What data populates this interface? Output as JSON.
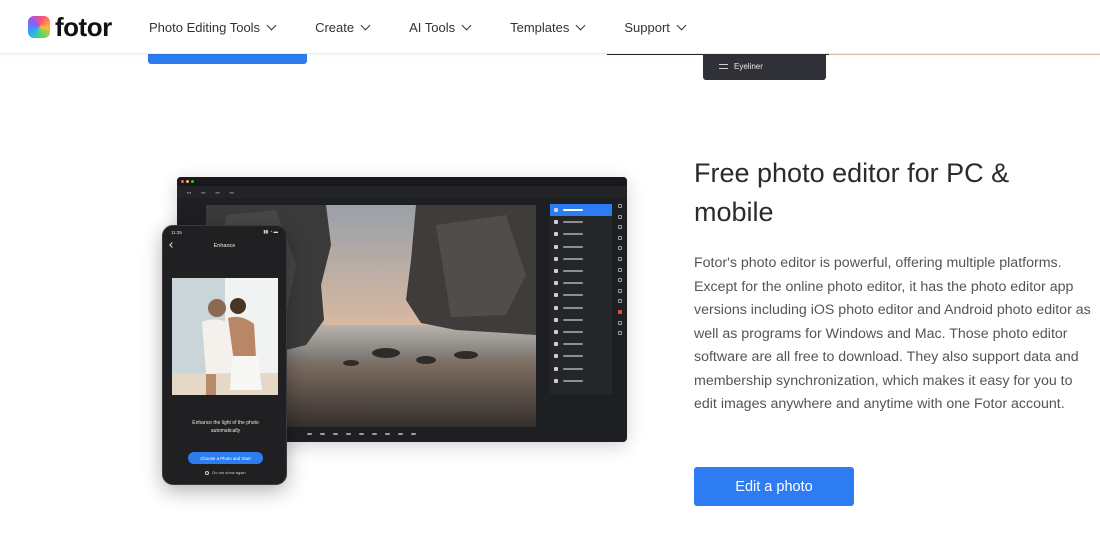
{
  "brand": {
    "name": "fotor"
  },
  "nav": [
    {
      "label": "Photo Editing Tools"
    },
    {
      "label": "Create"
    },
    {
      "label": "AI Tools"
    },
    {
      "label": "Templates"
    },
    {
      "label": "Support"
    }
  ],
  "previous_section": {
    "chip_label": "Eyeliner"
  },
  "illustration": {
    "phone_time": "11:35",
    "phone_header": "Enhance",
    "phone_caption": "Enhance the light of the photo automatically",
    "phone_button": "Choose a Photo and Start",
    "phone_checkbox": "Do not show again"
  },
  "feature": {
    "title": "Free photo editor for PC & mobile",
    "paragraph": "Fotor's photo editor is powerful, offering multiple platforms. Except for the online photo editor, it has the photo editor app versions including iOS photo editor and Android photo editor as well as programs for Windows and Mac. Those photo editor software are all free to download. They also support data and membership synchronization, which makes it easy for you to edit images anywhere and anytime with one Fotor account.",
    "cta_label": "Edit a photo"
  },
  "colors": {
    "accent": "#2d7cf2",
    "dark_app": "#1e1f22",
    "heading": "#2b2b2b",
    "body_text": "#555555"
  }
}
